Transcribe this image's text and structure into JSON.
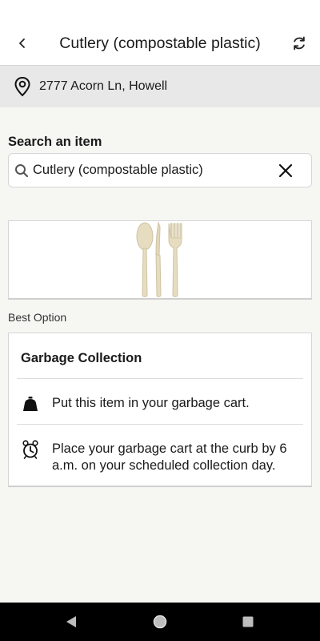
{
  "header": {
    "title": "Cutlery (compostable plastic)",
    "back_icon": "chevron-left-icon",
    "refresh_icon": "refresh-icon"
  },
  "address": {
    "text": "2777 Acorn Ln, Howell",
    "icon": "location-pin-icon"
  },
  "search": {
    "label": "Search an item",
    "value": "Cutlery (compostable plastic)",
    "search_icon": "search-icon",
    "clear_icon": "close-icon"
  },
  "item_image": {
    "icon": "cutlery-image"
  },
  "best_option_label": "Best Option",
  "option": {
    "title": "Garbage Collection",
    "rows": [
      {
        "icon": "garbage-cart-icon",
        "text": "Put this item in your garbage cart."
      },
      {
        "icon": "alarm-clock-icon",
        "text": "Place your garbage cart at the curb by 6 a.m. on your scheduled collection day."
      }
    ]
  },
  "navbar": {
    "back": "nav-back-icon",
    "home": "nav-home-icon",
    "recents": "nav-recents-icon"
  },
  "colors": {
    "background": "#f6f6f3",
    "header": "#ffffff",
    "address_bar": "#e8e8e8",
    "cutlery": "#e6dcc0",
    "navbar": "#000000"
  }
}
